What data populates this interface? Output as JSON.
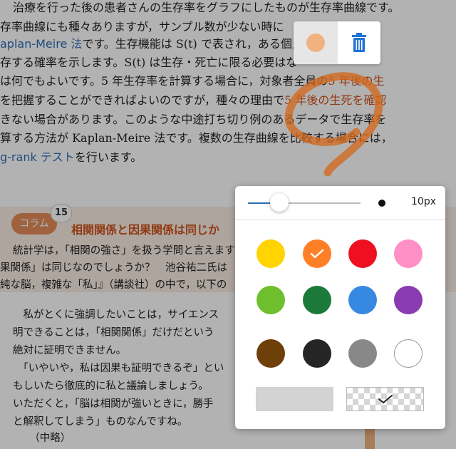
{
  "page": {
    "lines": [
      {
        "parts": [
          {
            "t": "治療を行った後の患者さんの生存率をグラフにしたものが生存率曲線です。"
          }
        ]
      },
      {
        "parts": [
          {
            "t": "存率曲線にも種々ありますが，サンプル数が少ない時に"
          }
        ]
      },
      {
        "parts": [
          {
            "t": "aplan-Meire 法",
            "c": "blue"
          },
          {
            "t": "です。生存機能は S(t) で表され，ある個人"
          }
        ]
      },
      {
        "parts": [
          {
            "t": "存する確率を示します。S(t) は生存・死亡に限る必要はな"
          }
        ]
      },
      {
        "parts": [
          {
            "t": "は何でもよいです。5 年生存率を計算する場合に，対象者全員の"
          },
          {
            "t": "5 年後の生",
            "c": "hl"
          }
        ]
      },
      {
        "parts": [
          {
            "t": "を把握することができればよいのですが，種々の理由で"
          },
          {
            "t": "5 年後の生死を確認",
            "c": "hl"
          }
        ]
      },
      {
        "parts": [
          {
            "t": "きない場合があります。このような中途打ち切り例のあるデータで生存率を"
          }
        ]
      },
      {
        "parts": [
          {
            "t": "算する方法が Kaplan-Meire 法です。複数の生存曲線を比較する場合には，"
          }
        ]
      },
      {
        "parts": [
          {
            "t": "g-rank テスト",
            "c": "blue"
          },
          {
            "t": "を行います。"
          }
        ]
      }
    ],
    "column": {
      "label": "コラム",
      "number": "15",
      "title": "相関関係と因果関係は同じか",
      "lines": [
        "統計学は，「相関の強さ」を扱う学問と言えます",
        "果関係」は同じなのでしょうか？　池谷祐二氏は",
        "純な脳，複雑な「私」』（講談社）の中で，以下の"
      ]
    },
    "body_lines": [
      "　私がとくに強調したいことは，サイエンス",
      "明できることは，「相関関係」だけだという",
      "絶対に証明できません。",
      "　「いやいや，私は因果も証明できるぞ」とい",
      "もしいたら徹底的に私と議論しましょう。",
      "いただくと，「脳は相関が強いときに，勝手",
      "と解釈してしまう」ものなんですね。",
      "　（中略）"
    ]
  },
  "toolbar": {
    "current_color": "#f0b27e",
    "current_color_icon": "filled-circle",
    "delete_icon": "trash-icon",
    "delete_color": "#1f74d6"
  },
  "pen_panel": {
    "size_label": "10px",
    "size_value": 10,
    "size_slider_fraction": 0.28,
    "colors": [
      {
        "name": "yellow",
        "hex": "#ffd400",
        "selected": false
      },
      {
        "name": "orange",
        "hex": "#ff7f27",
        "selected": true
      },
      {
        "name": "red",
        "hex": "#ee1020",
        "selected": false
      },
      {
        "name": "pink",
        "hex": "#ff8fc4",
        "selected": false
      },
      {
        "name": "light-green",
        "hex": "#6dbf2e",
        "selected": false
      },
      {
        "name": "green",
        "hex": "#1b7a3a",
        "selected": false
      },
      {
        "name": "blue",
        "hex": "#3688e0",
        "selected": false
      },
      {
        "name": "purple",
        "hex": "#8a3bb0",
        "selected": false
      },
      {
        "name": "brown",
        "hex": "#6e3f08",
        "selected": false
      },
      {
        "name": "black",
        "hex": "#252525",
        "selected": false
      },
      {
        "name": "gray",
        "hex": "#888888",
        "selected": false
      },
      {
        "name": "white",
        "hex": "#ffffff",
        "selected": false
      }
    ],
    "fill_modes": [
      {
        "name": "solid",
        "color": "#d3d3d3",
        "selected": false
      },
      {
        "name": "transparent",
        "selected": true
      }
    ]
  },
  "drawing": {
    "stroke_color": "#d2691e"
  }
}
